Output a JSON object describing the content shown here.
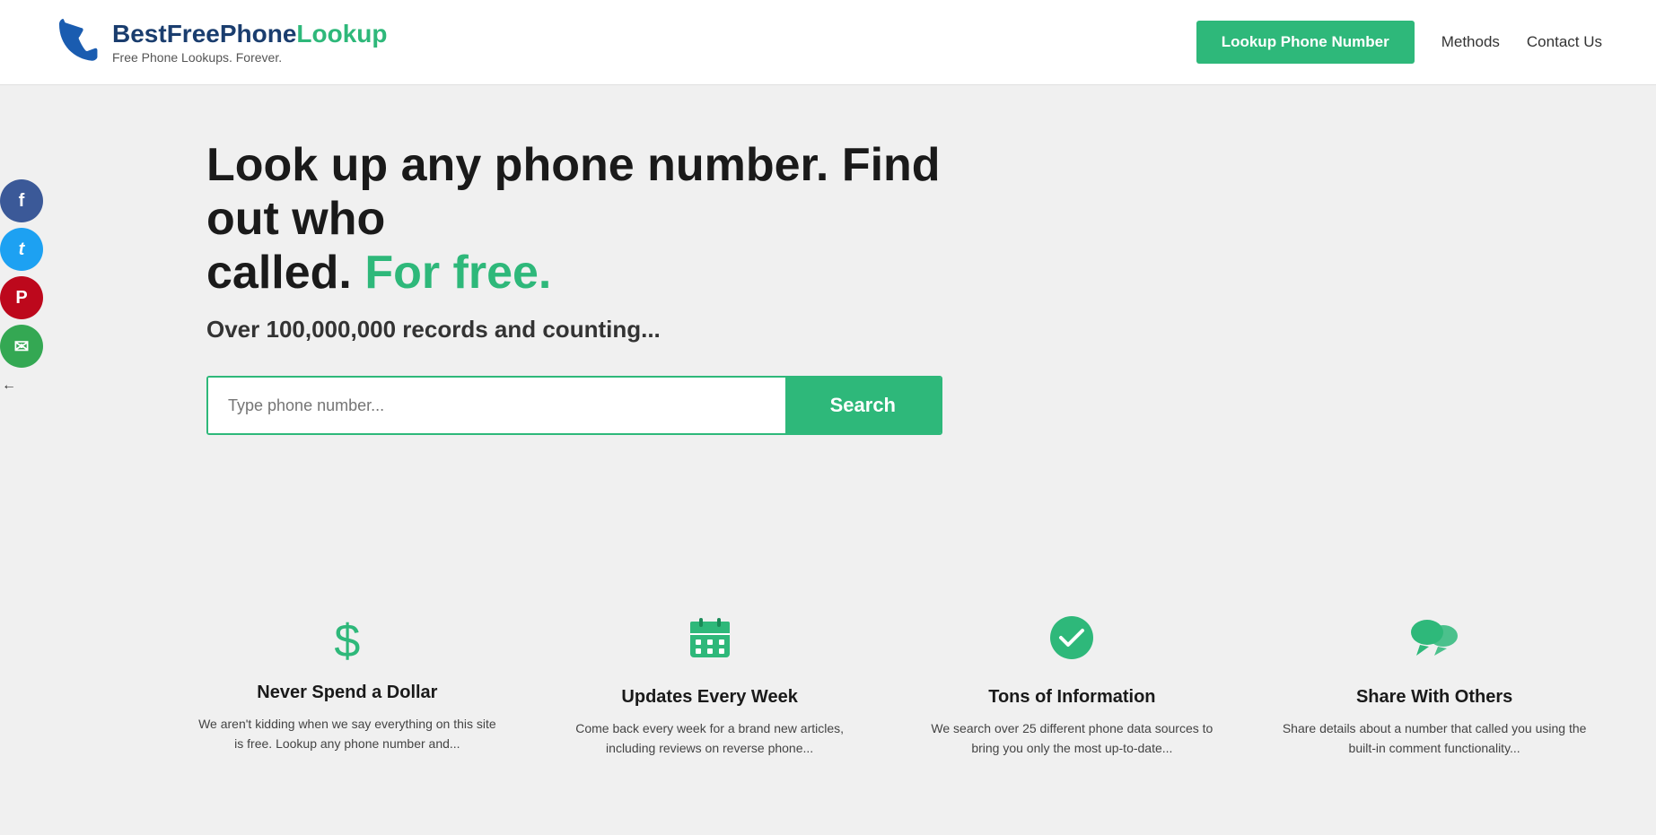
{
  "header": {
    "logo": {
      "text_best": "Best",
      "text_free": "Free",
      "text_phone": "Phone",
      "text_lookup": "Lookup",
      "tagline": "Free Phone Lookups. Forever."
    },
    "nav": {
      "lookup_btn": "Lookup Phone Number",
      "methods_link": "Methods",
      "contact_link": "Contact Us"
    }
  },
  "social": {
    "facebook": "f",
    "twitter": "t",
    "pinterest": "p",
    "email": "✉"
  },
  "hero": {
    "title_line1": "Look up any phone number. Find out who",
    "title_line2": "called.",
    "title_green": "For free.",
    "subtitle": "Over 100,000,000 records and counting...",
    "search_placeholder": "Type phone number...",
    "search_button": "Search"
  },
  "features": [
    {
      "id": "never-spend",
      "icon": "$",
      "title": "Never Spend a Dollar",
      "desc": "We aren't kidding when we say everything on this site is free. Lookup any phone number and..."
    },
    {
      "id": "updates",
      "icon": "📅",
      "title": "Updates Every Week",
      "desc": "Come back every week for a brand new articles, including reviews on reverse phone..."
    },
    {
      "id": "tons-info",
      "icon": "✔",
      "title": "Tons of Information",
      "desc": "We search over 25 different phone data sources to bring you only the most up-to-date..."
    },
    {
      "id": "share",
      "icon": "💬",
      "title": "Share With Others",
      "desc": "Share details about a number that called you using the built-in comment functionality..."
    }
  ]
}
